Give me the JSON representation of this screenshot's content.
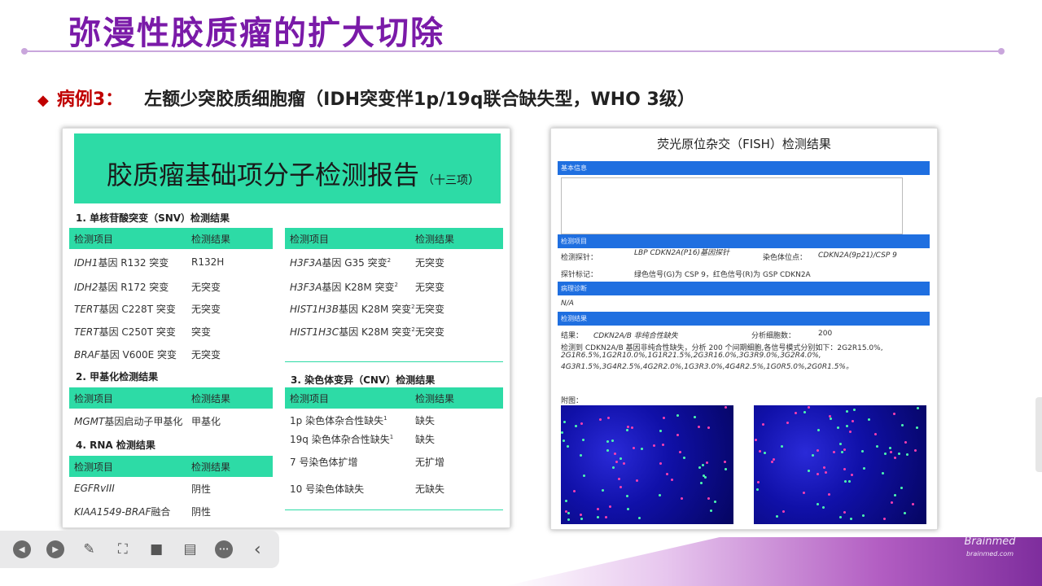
{
  "slide": {
    "title": "弥漫性胶质瘤的扩大切除",
    "case_label": "病例3：",
    "case_desc": "左额少突胶质细胞瘤（IDH突变伴1p/19q联合缺失型，WHO 3级）",
    "bullet": "◆"
  },
  "report": {
    "title": "胶质瘤基础项分子检测报告",
    "subtitle": "（十三项）",
    "col_item": "检测项目",
    "col_result": "检测结果",
    "sec1_title": "1.  单核苷酸突变（SNV）检测结果",
    "snv_left": [
      {
        "gene": "IDH1",
        "rest": "基因 R132 突变",
        "sup": "",
        "result": "R132H"
      },
      {
        "gene": "IDH2",
        "rest": "基因 R172 突变",
        "sup": "",
        "result": "无突变"
      },
      {
        "gene": "TERT",
        "rest": "基因 C228T 突变",
        "sup": "",
        "result": "无突变"
      },
      {
        "gene": "TERT",
        "rest": "基因 C250T 突变",
        "sup": "",
        "result": "突变"
      },
      {
        "gene": "BRAF",
        "rest": "基因 V600E 突变",
        "sup": "",
        "result": "无突变"
      }
    ],
    "snv_right": [
      {
        "gene": "H3F3A",
        "rest": "基因 G35 突变",
        "sup": "2",
        "result": "无突变"
      },
      {
        "gene": "H3F3A",
        "rest": "基因 K28M 突变",
        "sup": "2",
        "result": "无突变"
      },
      {
        "gene": "HIST1H3B",
        "rest": "基因 K28M 突变",
        "sup": "2",
        "result": "无突变"
      },
      {
        "gene": "HIST1H3C",
        "rest": "基因 K28M 突变",
        "sup": "2",
        "result": "无突变"
      }
    ],
    "sec2_title": "2.  甲基化检测结果",
    "meth": [
      {
        "gene": "MGMT",
        "rest": "基因启动子甲基化",
        "sup": "",
        "result": "甲基化"
      }
    ],
    "sec3_title": "3.   染色体变异（CNV）检测结果",
    "cnv": [
      {
        "gene": "",
        "rest": "1p 染色体杂合性缺失",
        "sup": "1",
        "result": "缺失"
      },
      {
        "gene": "",
        "rest": "19q 染色体杂合性缺失",
        "sup": "1",
        "result": "缺失"
      },
      {
        "gene": "",
        "rest": "7 号染色体扩增",
        "sup": "",
        "result": "无扩增"
      },
      {
        "gene": "",
        "rest": "10 号染色体缺失",
        "sup": "",
        "result": "无缺失"
      }
    ],
    "sec4_title": "4.   RNA 检测结果",
    "rna": [
      {
        "gene": "EGFRvIII",
        "rest": "",
        "sup": "",
        "result": "阴性"
      },
      {
        "gene": "KIAA1549-BRAF",
        "rest": "融合",
        "sup": "",
        "result": "阴性"
      }
    ]
  },
  "fish": {
    "title": "荧光原位杂交（FISH）检测结果",
    "bar1": "基本信息",
    "bar2": "检测项目",
    "probe_label": "检测探针：",
    "probe_value": "LBP CDKN2A(P16)基因探针",
    "site_label": "染色体位点：",
    "site_value": "CDKN2A(9p21)/CSP 9",
    "mark_label": "探针标记：",
    "mark_value": "绿色信号(G)为 CSP 9，红色信号(R)为 GSP CDKN2A",
    "bar3": "病理诊断",
    "diag": "N/A",
    "bar4": "检测结果",
    "result_label": "结果：",
    "result_value": "CDKN2A/B 非纯合性缺失",
    "cells_label": "分析细胞数：",
    "cells_value": "200",
    "detail1": "检测到 CDKN2A/B 基因非纯合性缺失，分析 200 个间期细胞,各信号模式分别如下：2G2R15.0%,",
    "detail2": "2G1R6.5%,1G2R10.0%,1G1R21.5%,2G3R16.0%,3G3R9.0%,3G2R4.0%,",
    "detail3": "4G3R1.5%,3G4R2.5%,4G2R2.0%,1G3R3.0%,4G4R2.5%,1G0R5.0%,2G0R1.5%。",
    "figure_label": "附图："
  },
  "toolbar": {
    "prev": "◀",
    "play": "▶",
    "pen": "✎",
    "crop": "⛶",
    "camera": "■",
    "comment": "▤",
    "more": "•••",
    "collapse": "‹"
  },
  "logo": {
    "main": "Brainmed",
    "sub": "brainmed.com"
  }
}
